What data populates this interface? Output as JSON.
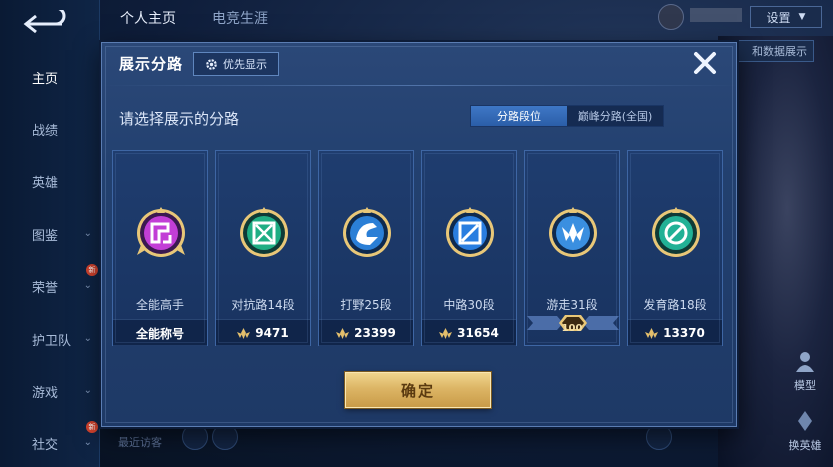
{
  "nav": {
    "items": [
      {
        "label": "主页"
      },
      {
        "label": "战绩"
      },
      {
        "label": "英雄"
      },
      {
        "label": "图鉴"
      },
      {
        "label": "荣誉",
        "badge": "新"
      },
      {
        "label": "护卫队"
      },
      {
        "label": "游戏"
      },
      {
        "label": "社交",
        "badge": "新"
      }
    ]
  },
  "top_tabs": [
    "个人主页",
    "电竞生涯"
  ],
  "top_right": {
    "settings_label": "设置",
    "side_button_label": "和数据展示"
  },
  "right_actions": {
    "model_label": "模型",
    "swap_hero_label": "换英雄"
  },
  "bottom_hint": "最近访客",
  "modal": {
    "title": "展示分路",
    "priority_label": "优先显示",
    "subtitle": "请选择展示的分路",
    "segments": [
      {
        "label": "分路段位",
        "active": true
      },
      {
        "label": "巅峰分路(全国)",
        "active": false
      }
    ],
    "cards": [
      {
        "name": "全能高手",
        "footer": "全能称号",
        "score": "",
        "accent": "#d44ce0",
        "icon": "all-round-emblem-icon"
      },
      {
        "name": "对抗路14段",
        "footer": "",
        "score": "9471",
        "accent": "#2fd3a4",
        "icon": "clash-lane-emblem-icon"
      },
      {
        "name": "打野25段",
        "footer": "",
        "score": "23399",
        "accent": "#4aa4f0",
        "icon": "jungle-emblem-icon"
      },
      {
        "name": "中路30段",
        "footer": "",
        "score": "31654",
        "accent": "#3b8ff0",
        "icon": "mid-lane-emblem-icon"
      },
      {
        "name": "游走31段",
        "footer": "",
        "score": "",
        "rank_plate": "100",
        "accent": "#5ab4f2",
        "icon": "roam-emblem-icon"
      },
      {
        "name": "发育路18段",
        "footer": "",
        "score": "13370",
        "accent": "#2fd3b4",
        "icon": "farm-lane-emblem-icon"
      }
    ],
    "confirm_label": "确定"
  },
  "colors": {
    "gold": "#e2be6c",
    "modal_bg": "#22406f",
    "active_tab": "#3a70bf"
  }
}
